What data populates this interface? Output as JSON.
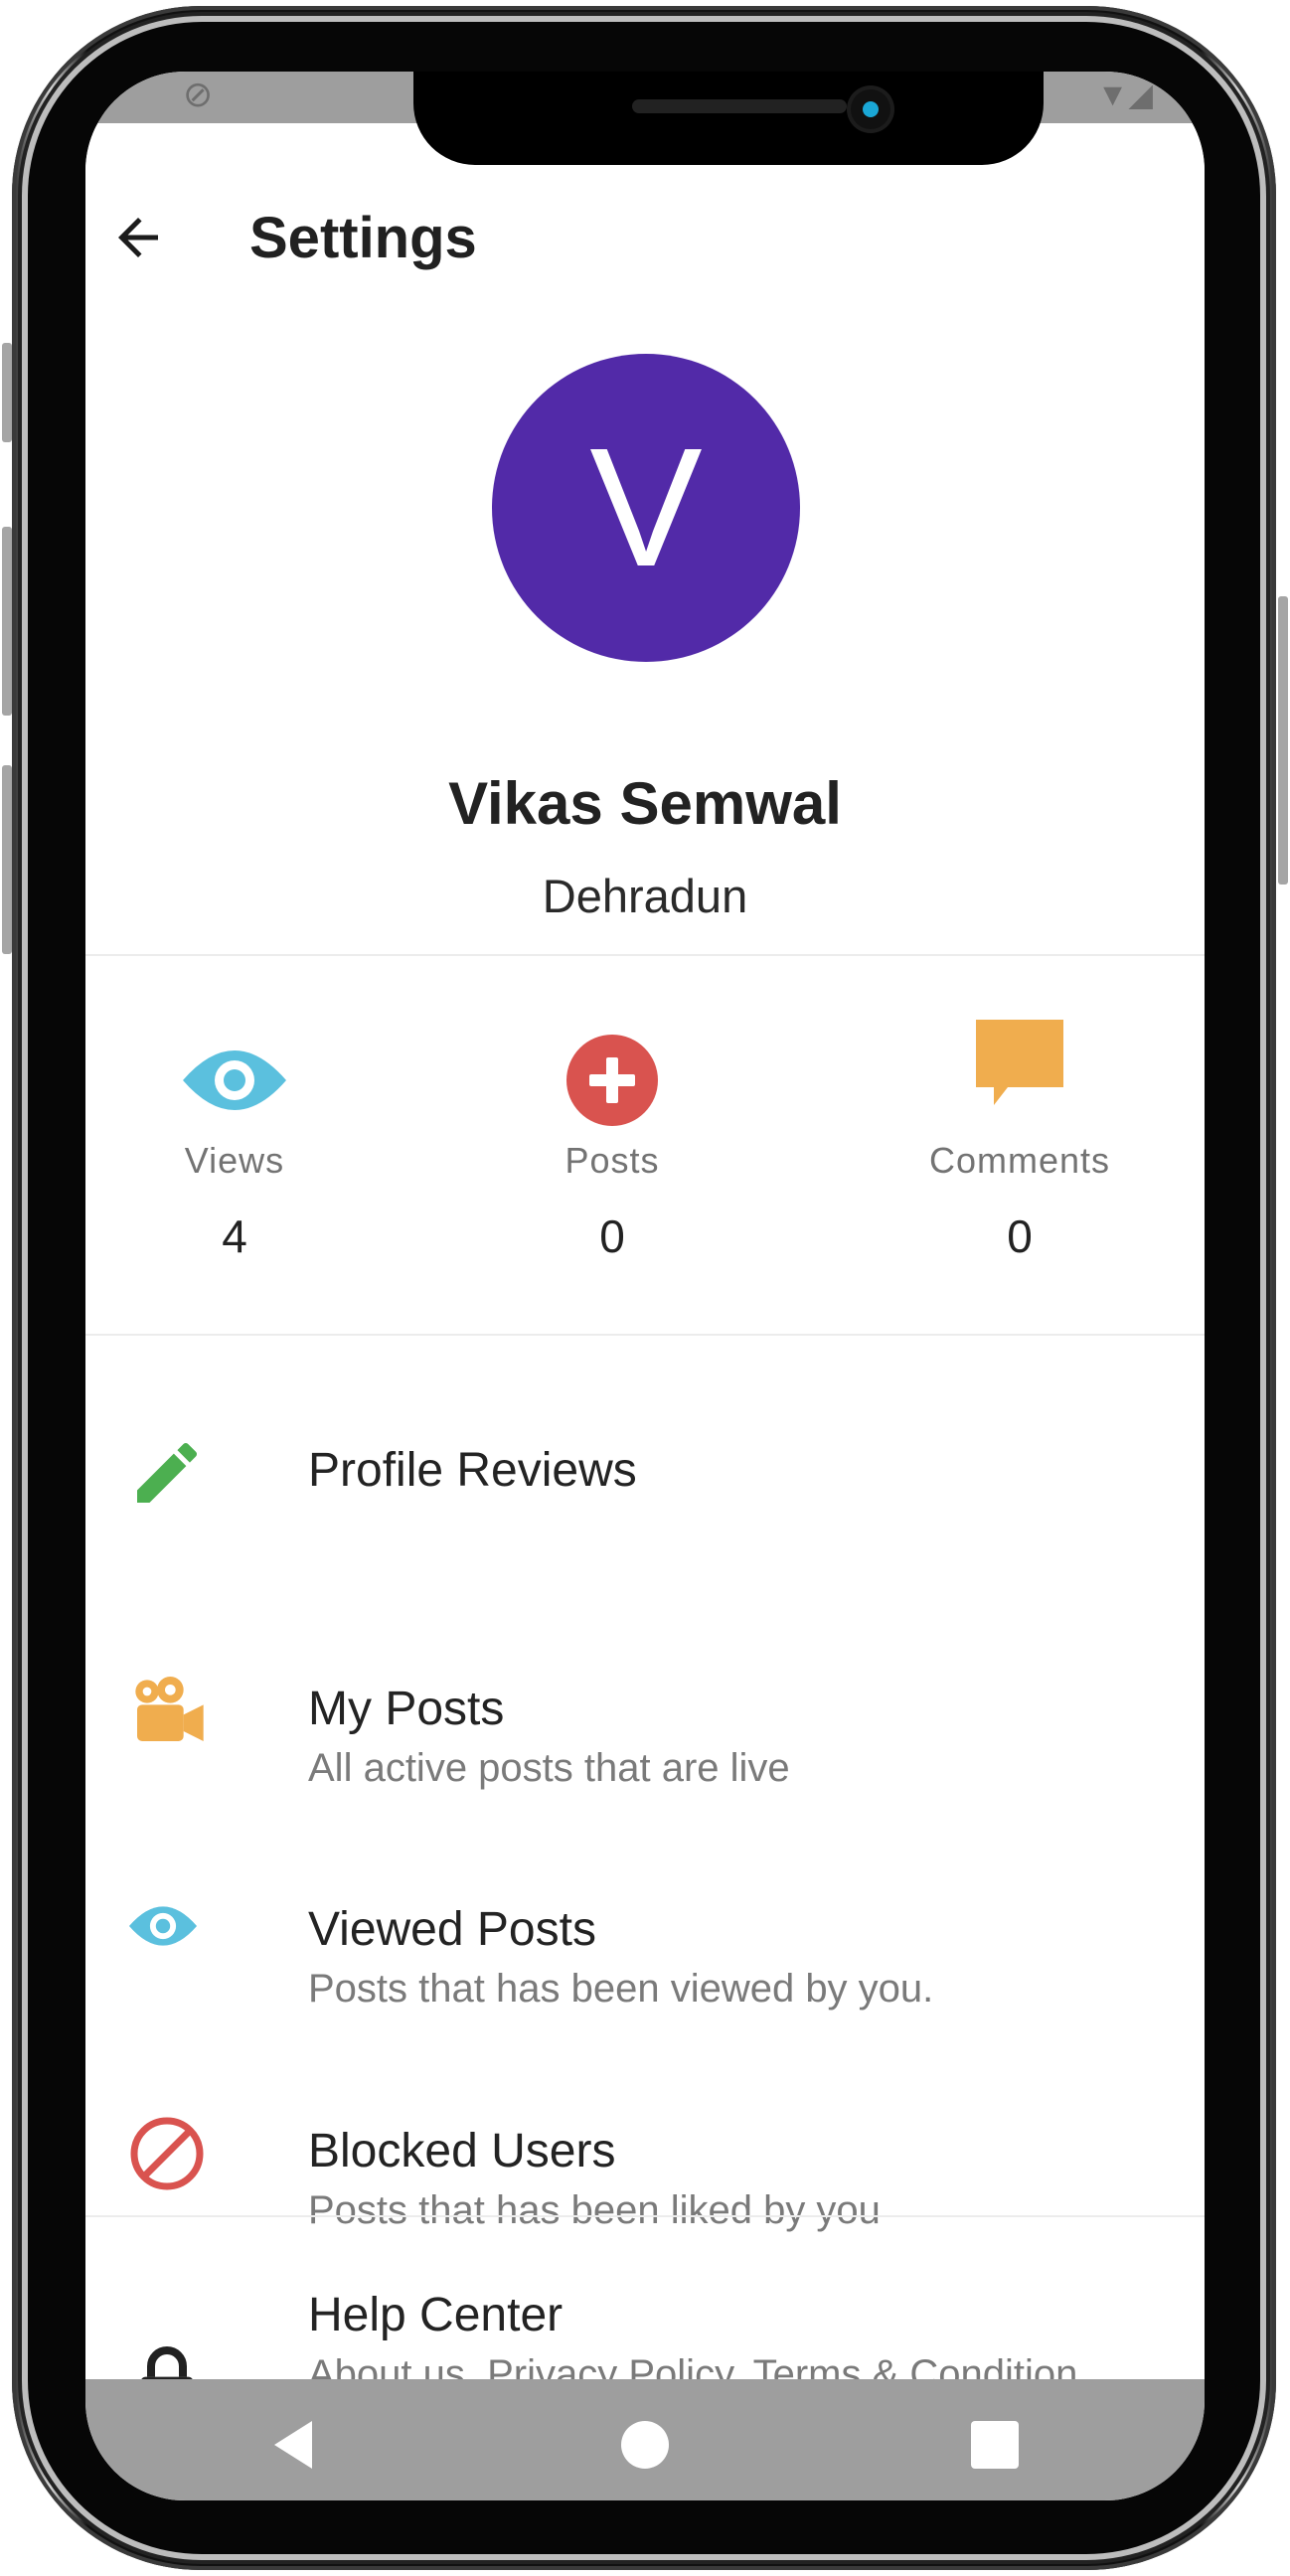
{
  "appbar": {
    "title": "Settings",
    "back_icon": "arrow-left-icon"
  },
  "profile": {
    "avatar_letter": "V",
    "avatar_color": "#522aa8",
    "name": "Vikas Semwal",
    "city": "Dehradun"
  },
  "stats": [
    {
      "label": "Views",
      "value": "4",
      "icon": "eye-icon",
      "color": "#5bc0de"
    },
    {
      "label": "Posts",
      "value": "0",
      "icon": "plus-circle-icon",
      "color": "#d9534f"
    },
    {
      "label": "Comments",
      "value": "0",
      "icon": "comment-icon",
      "color": "#f0ad4e"
    }
  ],
  "menu": [
    {
      "title": "Profile Reviews",
      "subtitle": "",
      "icon": "pencil-icon",
      "color": "#4caf50"
    },
    {
      "title": "My Posts",
      "subtitle": "All active posts that are live",
      "icon": "video-camera-icon",
      "color": "#f0ad4e"
    },
    {
      "title": "Viewed Posts",
      "subtitle": "Posts that has been viewed by you.",
      "icon": "eye-icon",
      "color": "#5bc0de"
    },
    {
      "title": "Blocked Users",
      "subtitle": "Posts that has been liked by you",
      "icon": "ban-icon",
      "color": "#d9534f"
    },
    {
      "title": "Help Center",
      "subtitle": "About us, Privacy Policy, Terms & Condition",
      "icon": "lock-icon",
      "color": "#212121"
    }
  ],
  "navbar": {
    "back": "nav-back-icon",
    "home": "nav-home-icon",
    "recents": "nav-recents-icon"
  }
}
